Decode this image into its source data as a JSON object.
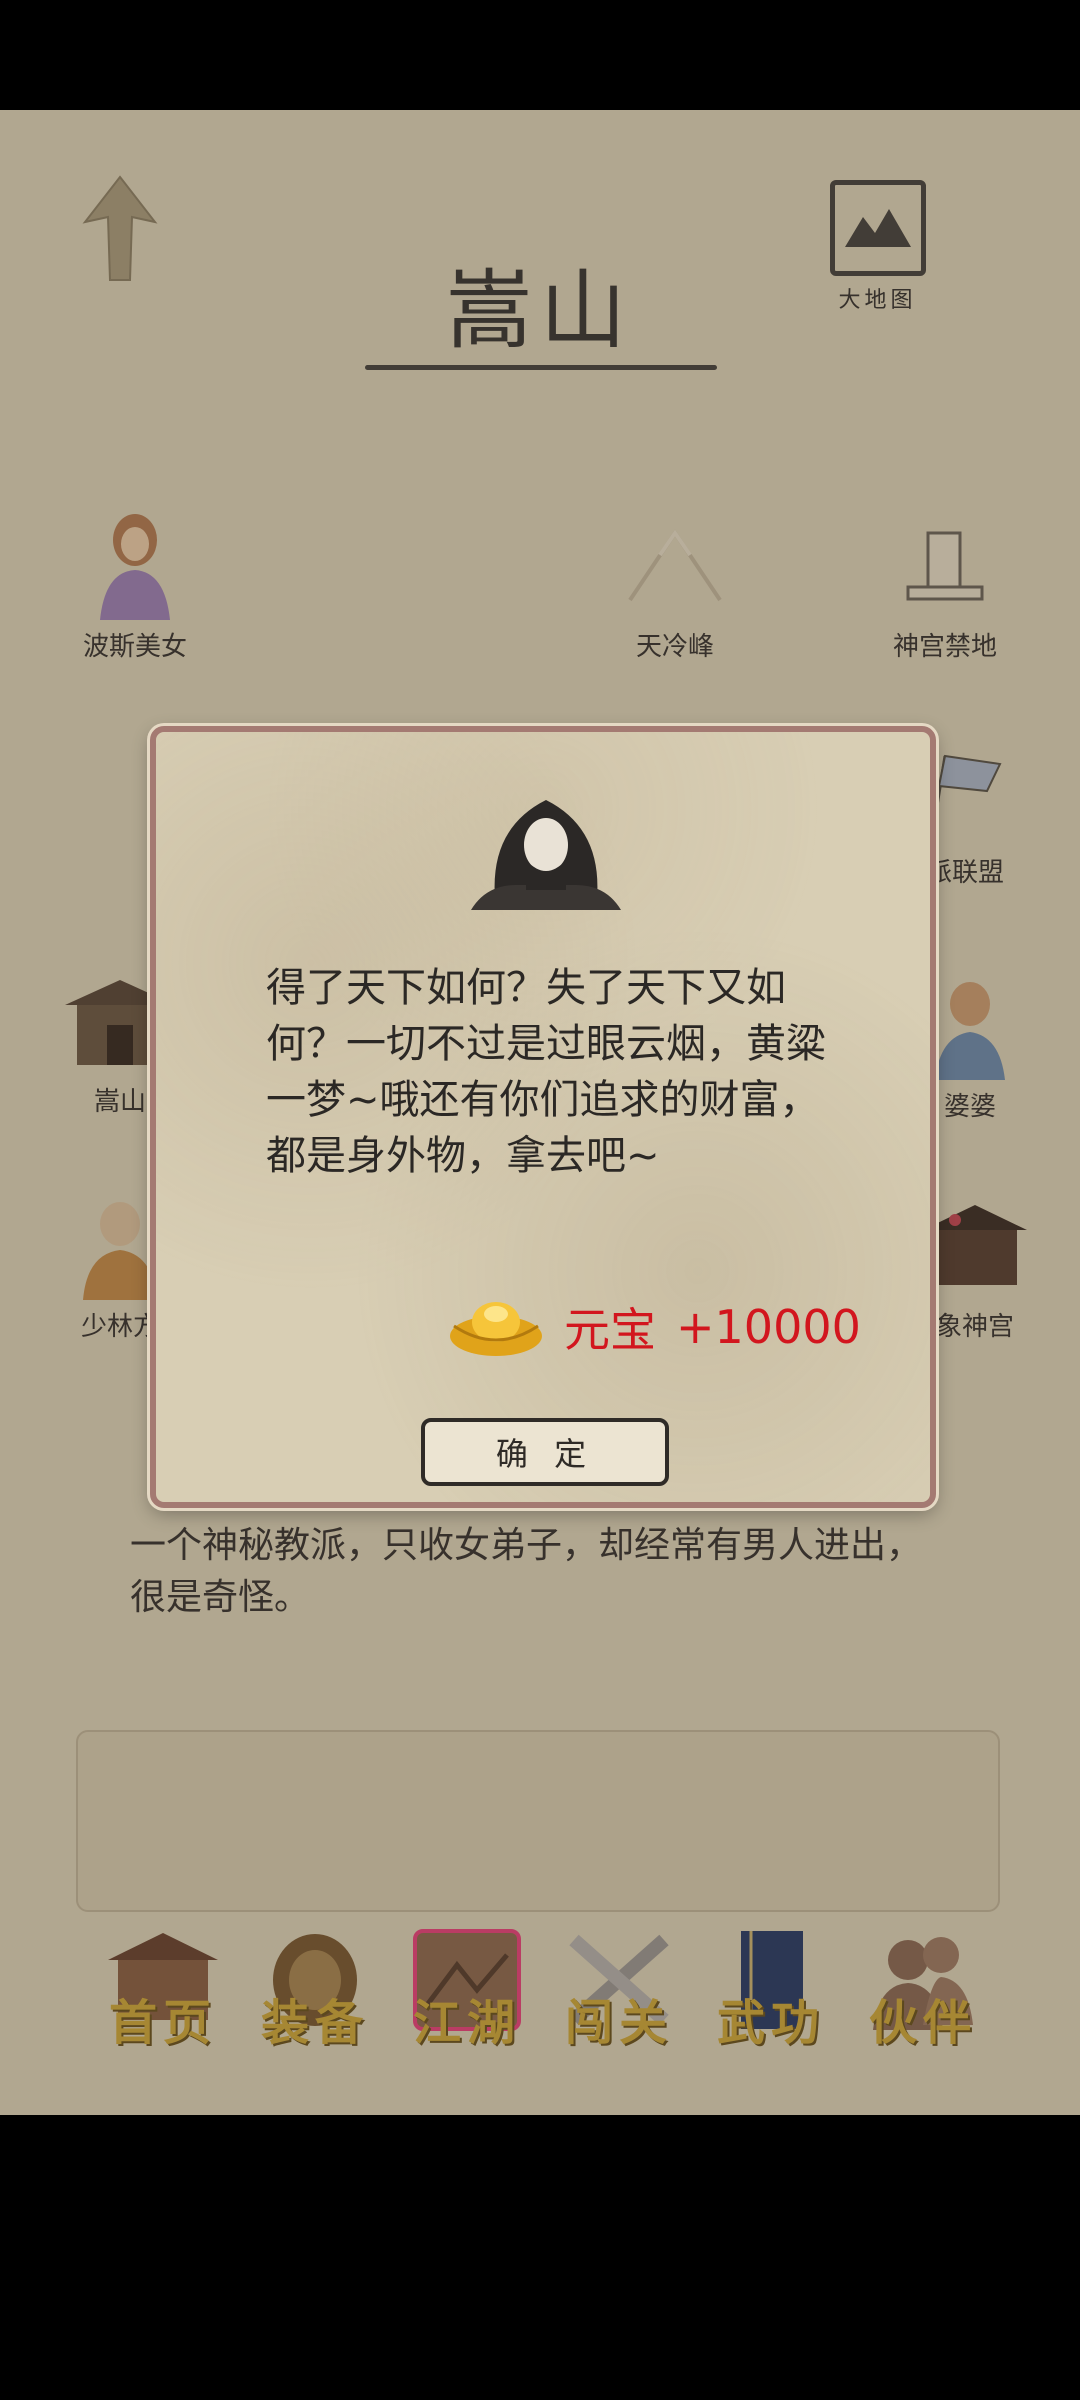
{
  "header": {
    "title": "嵩山",
    "map_label": "大地图"
  },
  "locations": [
    {
      "label": "波斯美女",
      "icon": "woman-portrait-icon"
    },
    {
      "label": "天冷峰",
      "icon": "mountain-peak-icon"
    },
    {
      "label": "神宫禁地",
      "icon": "stone-tablet-icon"
    },
    {
      "label": "派联盟",
      "icon": "flag-icon"
    },
    {
      "label": "嵩山",
      "icon": "temple-icon"
    },
    {
      "label": "婆婆",
      "icon": "old-woman-icon"
    },
    {
      "label": "少林方",
      "icon": "monk-icon"
    },
    {
      "label": "象神宫",
      "icon": "palace-icon"
    }
  ],
  "description": "一个神秘教派，只收女弟子，却经常有男人进出，很是奇怪。",
  "dialog": {
    "text": "得了天下如何？失了天下又如何？一切不过是过眼云烟，黄粱一梦~哦还有你们追求的财富，都是身外物，拿去吧~",
    "reward_name": "元宝",
    "reward_amount": "+10000",
    "confirm_label": "确 定"
  },
  "tabs": [
    {
      "label": "首页",
      "icon": "home-icon"
    },
    {
      "label": "装备",
      "icon": "armor-icon"
    },
    {
      "label": "江湖",
      "icon": "world-map-icon"
    },
    {
      "label": "闯关",
      "icon": "crossed-swords-icon"
    },
    {
      "label": "武功",
      "icon": "book-icon"
    },
    {
      "label": "伙伴",
      "icon": "partners-icon"
    }
  ],
  "colors": {
    "background": "#d8cdb2",
    "accent_red": "#d2161e",
    "gold": "#c9a43c",
    "dialog_border": "#a47a72"
  }
}
